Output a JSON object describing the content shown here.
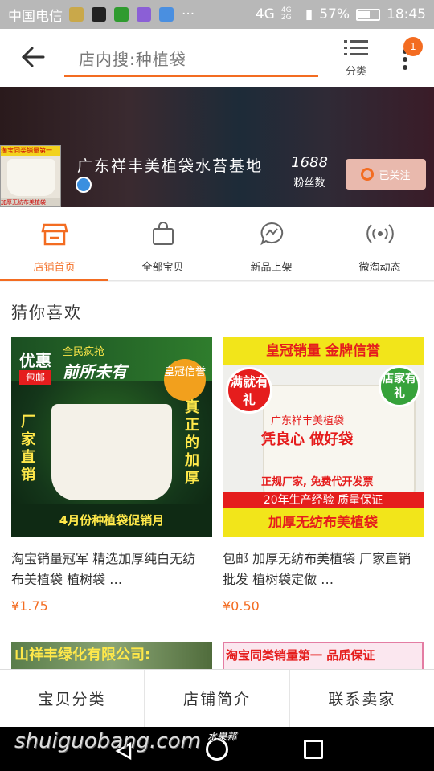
{
  "status_bar": {
    "carrier": "中国电信",
    "network_top": "4G",
    "network_stack": "4G 2G",
    "battery_percent": "57%",
    "battery_level": 0.57,
    "time": "18:45"
  },
  "top_nav": {
    "search_text": "店内搜:种植袋",
    "category_label": "分类",
    "badge_count": "1"
  },
  "store": {
    "logo_top_text": "淘宝同类销量第一",
    "logo_bottom_text": "加厚无纺布美植袋",
    "name": "广东祥丰美植袋水苔基地",
    "fans_count": "1688",
    "fans_label": "粉丝数",
    "follow_label": "已关注"
  },
  "tabs": [
    {
      "label": "店铺首页",
      "icon": "storefront-icon",
      "active": true
    },
    {
      "label": "全部宝贝",
      "icon": "shopping-bag-icon",
      "active": false
    },
    {
      "label": "新品上架",
      "icon": "chat-bubble-icon",
      "active": false
    },
    {
      "label": "微淘动态",
      "icon": "broadcast-icon",
      "active": false
    }
  ],
  "section": {
    "title": "猜你喜欢"
  },
  "products": [
    {
      "title": "淘宝销量冠军 精选加厚纯白无纺布美植袋 植树袋 …",
      "price": "¥1.75",
      "image": {
        "top1": "优惠",
        "top2": "全民疯抢",
        "top3": "前所未有",
        "tag": "包邮",
        "crown": "皇冠信誉",
        "left": "厂家直销",
        "right": "真正的加厚",
        "bottom": "4月份种植袋促销月"
      }
    },
    {
      "title": "包邮 加厚无纺布美植袋 厂家直销批发 植树袋定做 …",
      "price": "¥0.50",
      "image": {
        "top": "皇冠销量 金牌信誉",
        "badge_left": "满就有礼",
        "badge_right": "店家有礼",
        "line1": "广东祥丰美植袋",
        "line2": "凭良心 做好袋",
        "line3": "正规厂家, 免费代开发票",
        "bar": "20年生产经验 质量保证",
        "bottom": "加厚无纺布美植袋"
      }
    },
    {
      "banner_text": "山祥丰绿化有限公司:"
    },
    {
      "banner_text": "淘宝同类销量第一 品质保证"
    }
  ],
  "bottom_bar": {
    "item1": "宝贝分类",
    "item2": "店铺简介",
    "item3": "联系卖家"
  },
  "watermark": {
    "text": "shuiguobang.com",
    "cn": "水果邦"
  },
  "colors": {
    "accent": "#f36c21",
    "price": "#f36c21"
  }
}
